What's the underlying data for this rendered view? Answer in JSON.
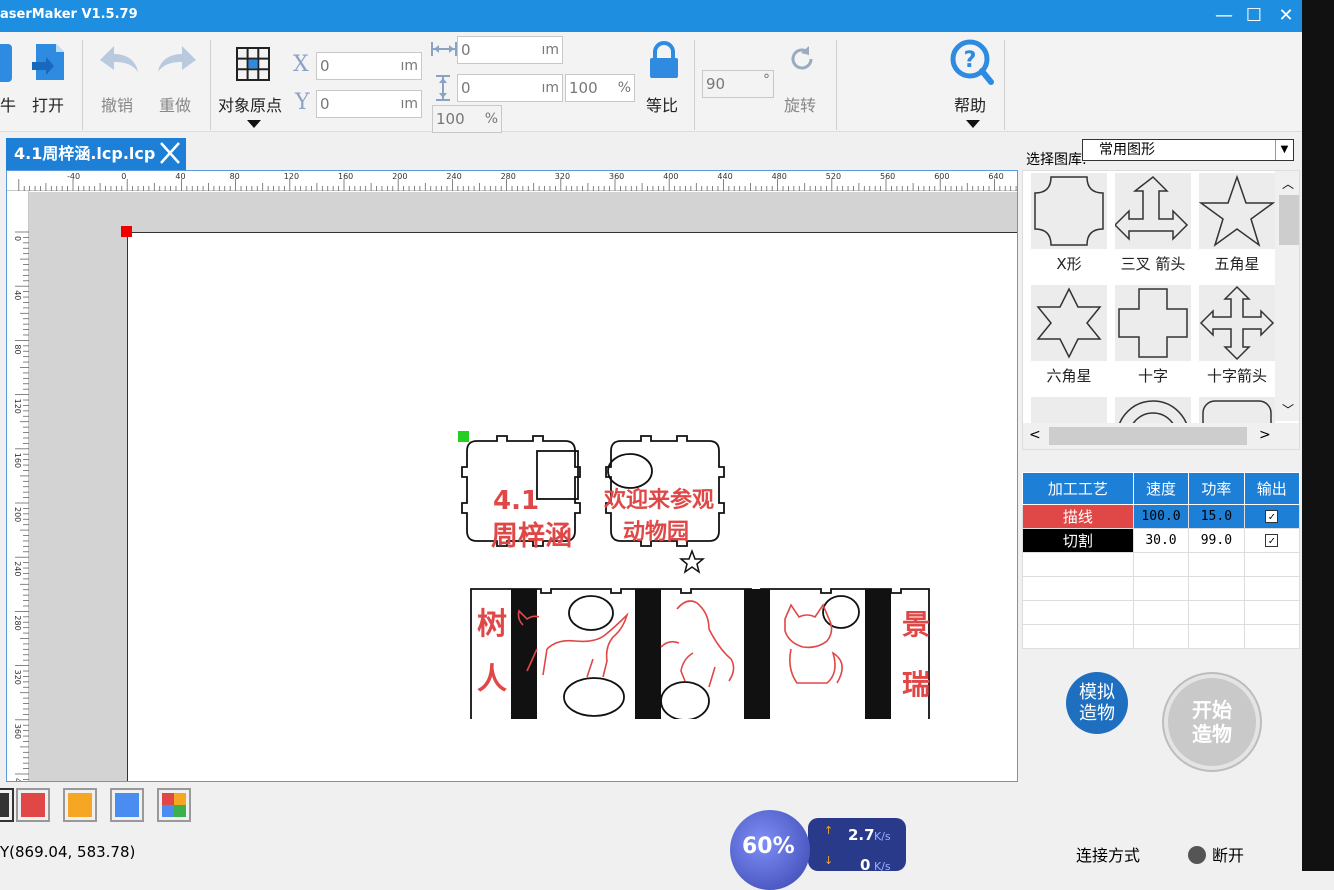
{
  "window": {
    "title": "aserMaker V1.5.79"
  },
  "toolbar": {
    "partial_label": "牛",
    "open_label": "打开",
    "undo_label": "撤销",
    "redo_label": "重做",
    "origin_label": "对象原点",
    "x_label": "X",
    "y_label": "Y",
    "x_value": "0",
    "y_value": "0",
    "width_value": "0",
    "height_value": "0",
    "unit": "ım",
    "width_pct": "100",
    "height_pct": "100",
    "pct_unit": "%",
    "lock_label": "等比",
    "rotate_value": "90",
    "deg_unit": "°",
    "rotate_label": "旋转",
    "help_label": "帮助"
  },
  "document": {
    "tab_name": "4.1周梓涵.lcp.lcp"
  },
  "ruler": {
    "top_labels": [
      "-40",
      "0",
      "40",
      "80",
      "120",
      "160",
      "200",
      "240",
      "280",
      "320",
      "360",
      "400",
      "440",
      "480",
      "520",
      "560",
      "600",
      "640"
    ],
    "left_labels": [
      "0",
      "40",
      "80",
      "120",
      "160",
      "200",
      "240",
      "280",
      "320",
      "360",
      "40"
    ]
  },
  "design": {
    "panel1_line1": "4.1",
    "panel1_line2": "周梓涵",
    "panel2_line1": "欢迎来参观",
    "panel2_line2": "动物园",
    "left_text_1": "树",
    "left_text_2": "人",
    "right_text_1": "景",
    "right_text_2": "瑞"
  },
  "library": {
    "label": "选择图库:",
    "selected": "常用图形",
    "shapes": [
      {
        "name": "X形",
        "icon": "x-shape-icon"
      },
      {
        "name": "三叉 箭头",
        "icon": "three-way-arrow-icon"
      },
      {
        "name": "五角星",
        "icon": "five-point-star-icon"
      },
      {
        "name": "六角星",
        "icon": "six-point-star-icon"
      },
      {
        "name": "十字",
        "icon": "cross-icon"
      },
      {
        "name": "十字箭头",
        "icon": "cross-arrow-icon"
      }
    ]
  },
  "process": {
    "headers": [
      "加工工艺",
      "速度",
      "功率",
      "输出"
    ],
    "rows": [
      {
        "name": "描线",
        "speed": "100.0",
        "power": "15.0",
        "color": "#e04848"
      },
      {
        "name": "切割",
        "speed": "30.0",
        "power": "99.0",
        "color": "#000000"
      }
    ]
  },
  "actions": {
    "simulate_line1": "模拟",
    "simulate_line2": "造物",
    "start_line1": "开始",
    "start_line2": "造物"
  },
  "palette": [
    "#333333",
    "#e04848",
    "#f5a623",
    "#4a8cf0",
    "multi"
  ],
  "status": {
    "coords": "Y(869.04, 583.78)",
    "connection_label": "连接方式",
    "connection_state": "断开"
  },
  "network": {
    "percent": "60%",
    "up_speed": "2.7",
    "down_speed": "0",
    "unit": "K/s"
  },
  "colors": {
    "accent": "#1e7fd6",
    "title": "#1e8fe0",
    "design_red": "#e04848"
  }
}
